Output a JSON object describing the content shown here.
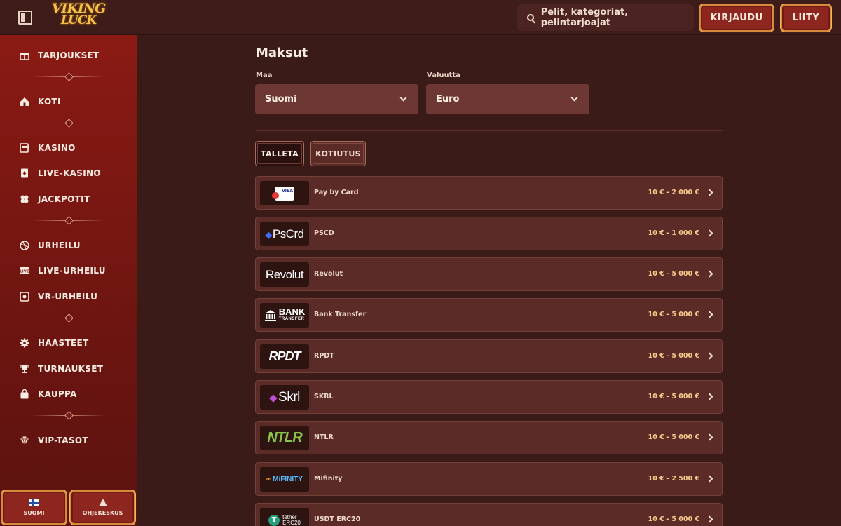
{
  "header": {
    "logo_line1": "VIKING",
    "logo_line2": "LUCK",
    "search_placeholder": "Pelit, kategoriat, pelintarjoajat",
    "login_label": "KIRJAUDU",
    "join_label": "LIITY"
  },
  "sidebar": {
    "items": [
      {
        "label": "TARJOUKSET",
        "icon": "gift-icon"
      },
      {
        "label": "KOTI",
        "icon": "home-icon"
      },
      {
        "label": "KASINO",
        "icon": "slot-machine-icon"
      },
      {
        "label": "LIVE-KASINO",
        "icon": "card-icon"
      },
      {
        "label": "JACKPOTIT",
        "icon": "clover-icon"
      },
      {
        "label": "URHEILU",
        "icon": "ball-icon"
      },
      {
        "label": "LIVE-URHEILU",
        "icon": "live-icon"
      },
      {
        "label": "VR-URHEILU",
        "icon": "vr-icon"
      },
      {
        "label": "HAASTEET",
        "icon": "gear-icon"
      },
      {
        "label": "TURNAUKSET",
        "icon": "trophy-icon"
      },
      {
        "label": "KAUPPA",
        "icon": "bag-icon"
      },
      {
        "label": "VIP-TASOT",
        "icon": "diamond-icon"
      }
    ],
    "footer": {
      "language_label": "SUOMI",
      "help_label": "OHJEKESKUS"
    }
  },
  "main": {
    "title": "Maksut",
    "country_label": "Maa",
    "country_value": "Suomi",
    "currency_label": "Valuutta",
    "currency_value": "Euro",
    "tabs": [
      {
        "label": "TALLETA",
        "active": true
      },
      {
        "label": "KOTIUTUS",
        "active": false
      }
    ],
    "methods": [
      {
        "name": "Pay by Card",
        "range": "10 € - 2 000 €",
        "logo_text": "VISA"
      },
      {
        "name": "PSCD",
        "range": "10 € - 1 000 €",
        "logo_text": "PsCrd"
      },
      {
        "name": "Revolut",
        "range": "10 € - 5 000 €",
        "logo_text": "Revolut"
      },
      {
        "name": "Bank Transfer",
        "range": "10 € - 5 000 €",
        "logo_text": "BANK",
        "logo_sub": "TRANSFER"
      },
      {
        "name": "RPDT",
        "range": "10 € - 5 000 €",
        "logo_text": "RPDT"
      },
      {
        "name": "SKRL",
        "range": "10 € - 5 000 €",
        "logo_text": "Skrl"
      },
      {
        "name": "NTLR",
        "range": "10 € - 5 000 €",
        "logo_text": "NTLR"
      },
      {
        "name": "Mifinity",
        "range": "10 € - 2 500 €",
        "logo_text": "MiFINITY"
      },
      {
        "name": "USDT ERC20",
        "range": "10 € - 5 000 €",
        "logo_text": "tether",
        "logo_sub": "ERC20"
      }
    ]
  }
}
